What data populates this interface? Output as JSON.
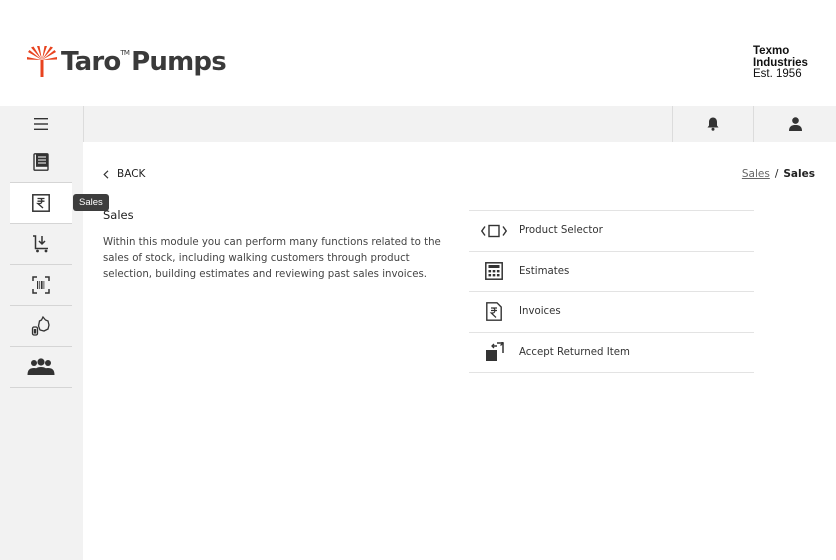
{
  "brand": {
    "logo_name": "Taro",
    "logo_tm": "TM",
    "logo_suffix": "Pumps",
    "logo_color": "#e8431f",
    "company_line1": "Texmo",
    "company_line2": "Industries",
    "company_line3": "Est. 1956"
  },
  "topbar": {
    "menu_icon": "hamburger-icon",
    "bell_icon": "bell-icon",
    "user_icon": "user-icon"
  },
  "sidebar": {
    "items": [
      {
        "icon": "book-icon",
        "active": false
      },
      {
        "icon": "rupee-icon",
        "active": true
      },
      {
        "icon": "cart-download-icon",
        "active": false
      },
      {
        "icon": "barcode-scan-icon",
        "active": false
      },
      {
        "icon": "pump-icon",
        "active": false
      },
      {
        "icon": "customers-icon",
        "active": false
      }
    ],
    "tooltip": "Sales"
  },
  "nav": {
    "back_label": "BACK",
    "breadcrumb_link": "Sales",
    "breadcrumb_sep": "/",
    "breadcrumb_current": "Sales"
  },
  "main": {
    "title": "Sales",
    "description": "Within this module you can perform many functions related to the sales of stock, including walking customers through product selection, building estimates and reviewing past sales invoices."
  },
  "menu": {
    "items": [
      {
        "label": "Product Selector",
        "icon": "product-selector-icon"
      },
      {
        "label": "Estimates",
        "icon": "calculator-icon"
      },
      {
        "label": "Invoices",
        "icon": "invoice-icon"
      },
      {
        "label": "Accept Returned Item",
        "icon": "return-icon"
      }
    ]
  }
}
